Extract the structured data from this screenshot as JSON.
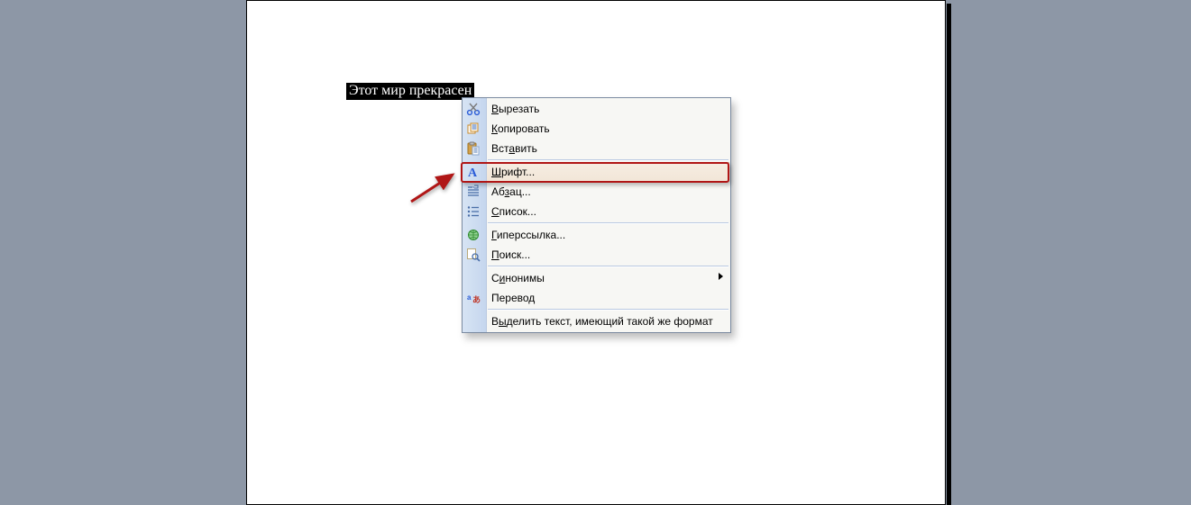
{
  "document": {
    "selected_text": "Этот мир прекрасен"
  },
  "context_menu": {
    "items": {
      "cut": {
        "label": "Вырезать",
        "u": 0
      },
      "copy": {
        "label": "Копировать",
        "u": 0
      },
      "paste": {
        "label": "Вставить",
        "u": 3
      },
      "font": {
        "label": "Шрифт...",
        "u": 0
      },
      "paragraph": {
        "label": "Абзац...",
        "u": 2
      },
      "list": {
        "label": "Список...",
        "u": 0
      },
      "hyperlink": {
        "label": "Гиперссылка...",
        "u": 0
      },
      "find": {
        "label": "Поиск...",
        "u": 0
      },
      "synonyms": {
        "label": "Синонимы",
        "u": 1
      },
      "translate": {
        "label": "Перевод",
        "u": -1
      },
      "select_fmt": {
        "label": "Выделить текст, имеющий такой же формат",
        "u": 1
      }
    }
  },
  "annotation": {
    "highlighted_item": "font"
  }
}
